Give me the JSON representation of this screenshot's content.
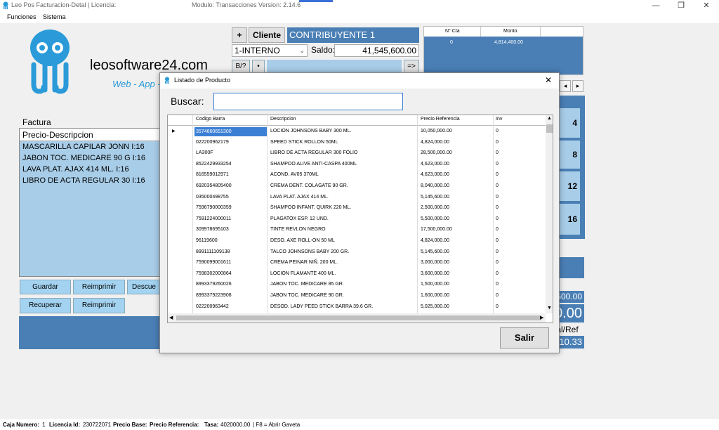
{
  "window": {
    "title": "Leo Pos Facturacion-Detal | Licencia:",
    "module": "Modulo: Transacciones Version:  2.14.6",
    "minimize": "—",
    "restore": "❐",
    "close": "✕"
  },
  "menu": {
    "funciones": "Funciones",
    "sistema": "Sistema"
  },
  "brand": {
    "site": "leosoftware24.com",
    "tagline": "Web - App -"
  },
  "customer": {
    "plus": "+",
    "cliente_label": "Cliente",
    "cliente_name": "CONTRIBUYENTE 1",
    "tipo": "1-INTERNO",
    "saldo_label": "Saldo:",
    "saldo_value": "41,545,600.00",
    "b_label": "B/?",
    "dot_label": "•",
    "arrow_label": "=>"
  },
  "cuotas": {
    "col1": "N° Cta",
    "col2": "Monto",
    "row_n": "0",
    "row_monto": "4,814,400.00"
  },
  "right_nums": [
    "4",
    "8",
    "12",
    "16"
  ],
  "nav": {
    "prev": "◂",
    "next": "▸"
  },
  "totals": {
    "v1": "600.00",
    "v2": "0.00",
    "label": "tal/Ref",
    "v3": "10.33"
  },
  "factura": {
    "label": "Factura",
    "header": "Precio-Descripcion",
    "items": [
      "MASCARILLA CAPILAR JONN  I:16",
      "JABON TOC. MEDICARE 90 G I:16",
      "LAVA PLAT. AJAX 414 ML. I:16",
      "LIBRO DE ACTA REGULAR 30 I:16"
    ]
  },
  "actions": {
    "guardar": "Guardar",
    "reimprimir": "Reimprimir",
    "descuento": "Descue",
    "recuperar": "Recuperar",
    "reimprimir2": "Reimprimir"
  },
  "status": {
    "caja_label": "Caja Numero:",
    "caja": "1",
    "licencia_label": "Licencia Id:",
    "licencia": "230722071",
    "precio_base_label": "Precio Base:",
    "precio_ref_label": "Precio Referencia:",
    "tasa_label": "Tasa:",
    "tasa": "4020000.00",
    "f8": "| F8 = Abrir Gaveta"
  },
  "dialog": {
    "title": "Listado de Producto",
    "close": "✕",
    "buscar_label": "Buscar:",
    "buscar_value": "",
    "salir": "Salir",
    "columns": [
      "Codigo Barra",
      "Descripcion",
      "Precio Referencia",
      "Inv"
    ],
    "rows": [
      [
        "3574660651300",
        "LOCION JOHNSONS BABY 300 ML.",
        "10,050,000.00",
        "0"
      ],
      [
        "022200962179",
        "SPEED STICK ROLLON 50ML",
        "4,824,000.00",
        "0"
      ],
      [
        "LA300F",
        "LIBRO DE ACTA REGULAR 300 FOLIO",
        "28,500,000.00",
        "0"
      ],
      [
        "8522429933254",
        "SHAMPOO ALIVE ANTI-CASPA 400ML",
        "4,623,000.00",
        "0"
      ],
      [
        "816559012971",
        "ACOND. AV05 370ML",
        "4,623,000.00",
        "0"
      ],
      [
        "6920354805400",
        "CREMA DENT. COLAGATE 90 GR.",
        "8,040,000.00",
        "0"
      ],
      [
        "035000498755",
        "LAVA PLAT. AJAX 414 ML.",
        "5,145,600.00",
        "0"
      ],
      [
        "7596790000359",
        "SHAMPOO INFANT. QUIRK 220 ML.",
        "2,500,000.00",
        "0"
      ],
      [
        "7591224000011",
        "PLAGATOX ESP. 12 UND.",
        "5,500,000.00",
        "0"
      ],
      [
        "309978695103",
        "TINTE REVLON NEGRO",
        "17,500,000.00",
        "0"
      ],
      [
        "96119600",
        "DESO. AXE ROLL-ON 50 ML",
        "4,824,000.00",
        "0"
      ],
      [
        "8991111109138",
        "TALCO JOHNSONS BABY 200 GR.",
        "5,145,600.00",
        "0"
      ],
      [
        "7590099001611",
        "CREMA PEINAR NIÑ. 200 ML.",
        "3,000,000.00",
        "0"
      ],
      [
        "7598302000864",
        "LOCION FLAMANTE 400 ML.",
        "3,600,000.00",
        "0"
      ],
      [
        "8993379260026",
        "JABON TOC. MEDICARE 85 GR.",
        "1,500,000.00",
        "0"
      ],
      [
        "8993379223908",
        "JABON TOC. MEDICARE 90 GR.",
        "1,600,000.00",
        "0"
      ],
      [
        "022200963442",
        "DESOD. LADY PEED STICK BARRA 39.6 GR.",
        "5,025,000.00",
        "0"
      ]
    ]
  }
}
